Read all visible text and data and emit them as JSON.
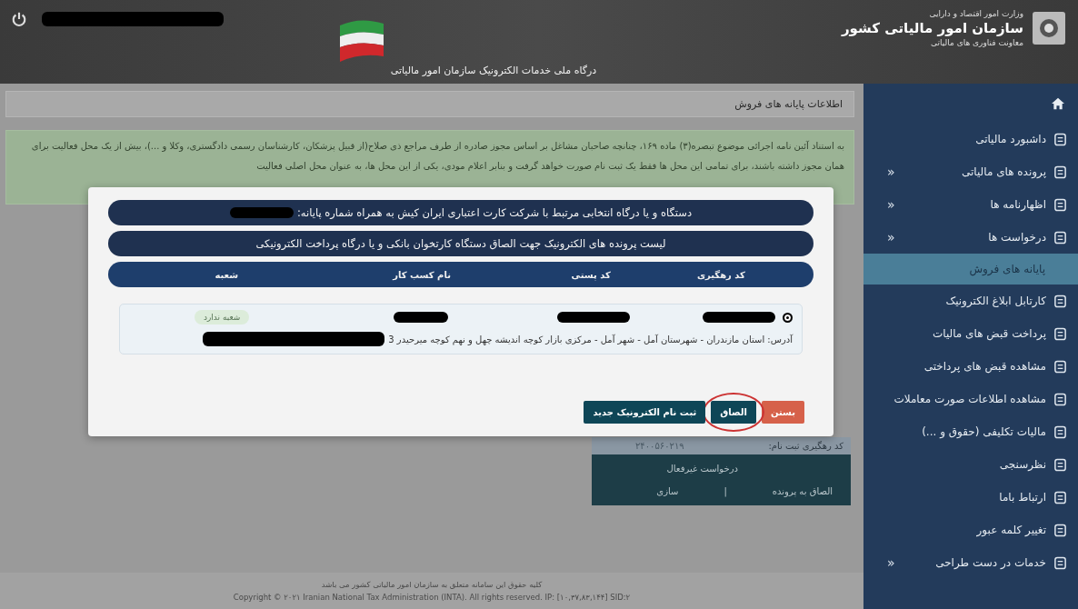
{
  "header": {
    "portal_title": "درگاه ملی خدمات الکترونیک سازمان امور مالیاتی",
    "ministry": "وزارت امور اقتصاد و دارایی",
    "organization": "سازمان امور مالیاتی کشور",
    "deputy": "معاونت فناوری های مالیاتی"
  },
  "sidebar": {
    "items": [
      {
        "kind": "home"
      },
      {
        "kind": "link",
        "label": "داشبورد مالیاتی",
        "selected": false
      },
      {
        "kind": "link",
        "label": "پرونده های مالیاتی",
        "selected": false,
        "submenu": "«"
      },
      {
        "kind": "link",
        "label": "اظهارنامه ها",
        "selected": false,
        "submenu": "«"
      },
      {
        "kind": "link",
        "label": "درخواست ها",
        "selected": false,
        "submenu": "«"
      },
      {
        "kind": "sub",
        "label": "پایانه های فروش",
        "selected": true
      },
      {
        "kind": "link",
        "label": "کارتابل ابلاغ الکترونیک",
        "selected": false
      },
      {
        "kind": "link",
        "label": "پرداخت قبض های مالیات",
        "selected": false
      },
      {
        "kind": "link",
        "label": "مشاهده قبض های پرداختی",
        "selected": false
      },
      {
        "kind": "link",
        "label": "مشاهده اطلاعات صورت معاملات",
        "selected": false
      },
      {
        "kind": "link",
        "label": "مالیات تکلیفی (حقوق و ...)",
        "selected": false
      },
      {
        "kind": "link",
        "label": "نظرسنجی",
        "selected": false
      },
      {
        "kind": "link",
        "label": "ارتباط باما",
        "selected": false
      },
      {
        "kind": "link",
        "label": "تغییر کلمه عبور",
        "selected": false
      },
      {
        "kind": "link",
        "label": "خدمات در دست طراحی",
        "selected": false,
        "submenu": "«"
      }
    ]
  },
  "breadcrumb": "اطلاعات پایانه های فروش",
  "notice": "به استناد آئین نامه اجرائی موضوع تبصره(۳) ماده ۱۶۹، چنانچه صاحبان مشاغل بر اساس مجوز صادره از طرف مراجع ذی صلاح(از قبیل پزشکان، کارشناسان رسمی دادگستری، وکلا و ...)، بیش از یک محل فعالیت برای همان مجوز داشته باشند، برای تمامی این محل ها فقط یک ثبت نام صورت خواهد گرفت و بنابر اعلام مودی، یکی از این محل ها، به عنوان محل اصلی فعالیت",
  "status_card": {
    "tracking_label": "کد رهگیری ثبت نام:",
    "tracking_code": "۲۴۰۰۵۶۰۲۱۹",
    "status": "درخواست غیرفعال",
    "actions": [
      "الصاق به پرونده",
      "سازی"
    ],
    "separator": "|"
  },
  "modal": {
    "device_bar": "دستگاه و یا درگاه انتخابی مرتبط با شرکت کارت اعتباری ایران کیش به همراه شماره پایانه:",
    "list_title": "لیست پرونده های الکترونیک جهت الصاق دستگاه کارتخوان بانکی و یا درگاه پرداخت الکترونیکی",
    "columns": [
      "کد رهگیری",
      "کد پستی",
      "نام کسب کار",
      "شعبه"
    ],
    "rows": [
      {
        "selected": true,
        "branch": "شعبه ندارد",
        "address": "آدرس: استان مازندران - شهرستان آمل - شهر آمل - مرکزی بازار کوچه اندیشه چهل و نهم کوچه میرحیدر 3"
      }
    ],
    "buttons": [
      {
        "kind": "danger",
        "label": "بستن",
        "highlighted": false
      },
      {
        "kind": "primary",
        "label": "الصاق",
        "highlighted": true
      },
      {
        "kind": "primary",
        "label": "ثبت نام الکترونیک جدید",
        "highlighted": false
      }
    ]
  },
  "footer": {
    "rights": "کلیه حقوق این سامانه متعلق به سازمان امور مالیاتی کشور می باشد",
    "copyright": "Copyright © ۲۰۲۱ Iranian National Tax Administration (INTA). All rights reserved. IP: [۱۰,۳۷,۸۳,۱۴۴] SID:۲"
  }
}
